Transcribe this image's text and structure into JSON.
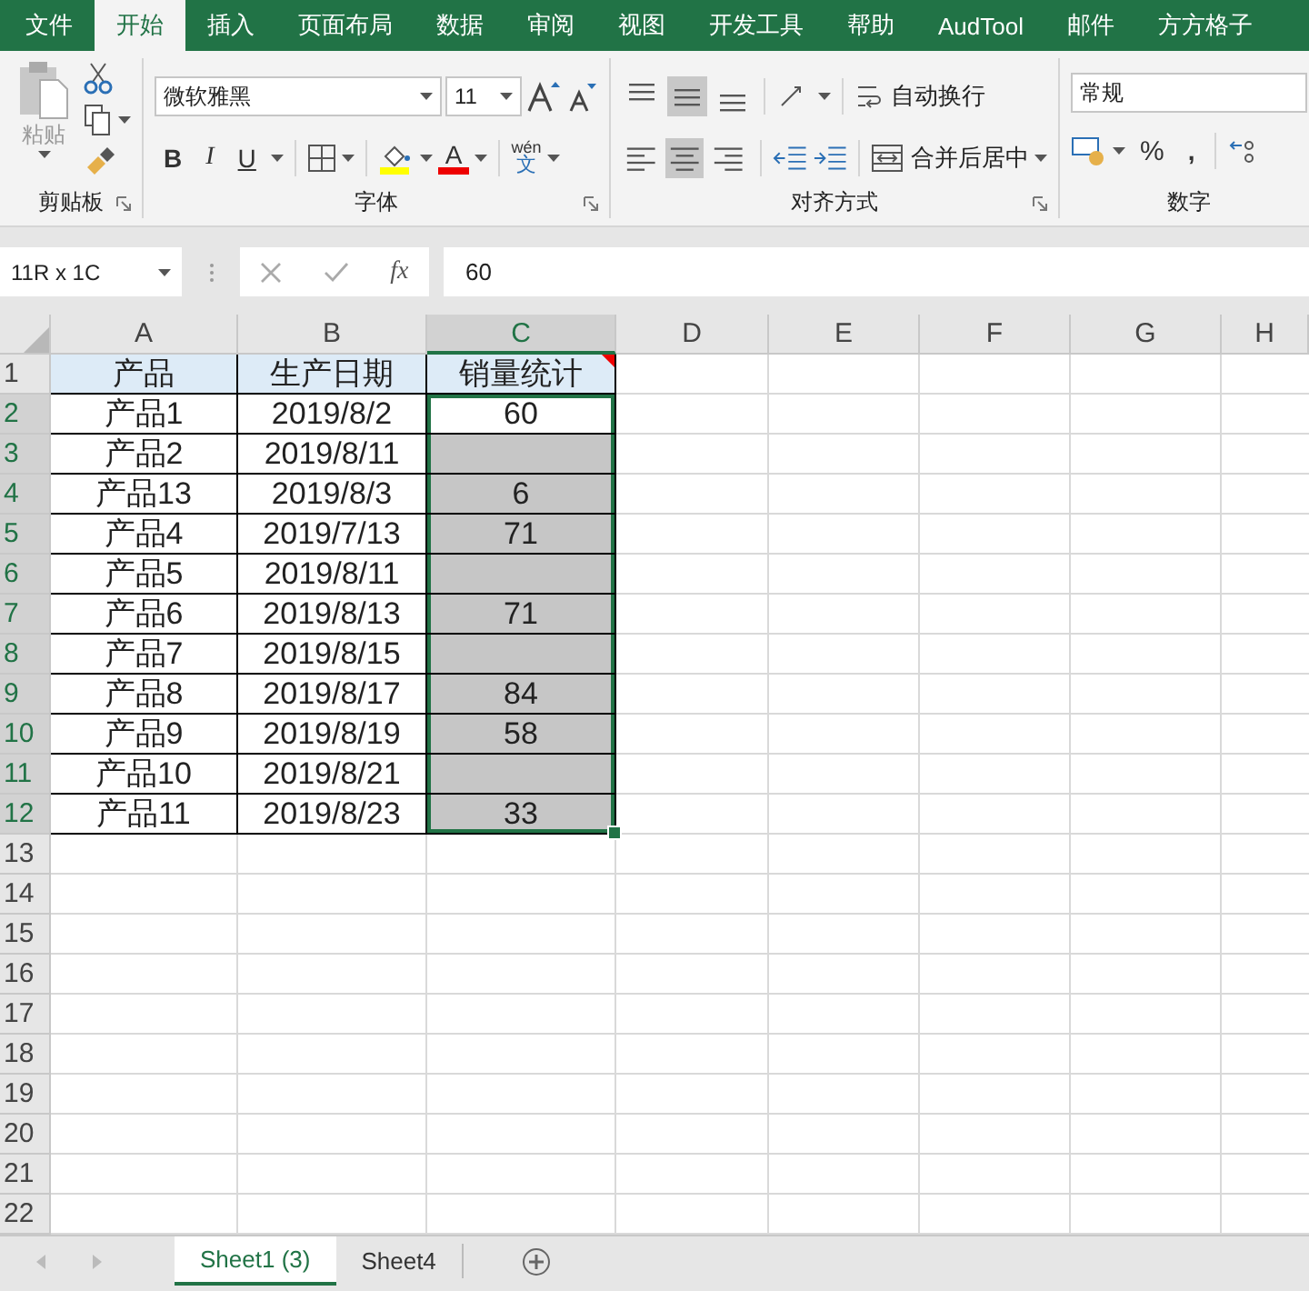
{
  "ribbon_tabs": [
    {
      "label": "文件",
      "selected": false
    },
    {
      "label": "开始",
      "selected": true
    },
    {
      "label": "插入",
      "selected": false
    },
    {
      "label": "页面布局",
      "selected": false
    },
    {
      "label": "数据",
      "selected": false
    },
    {
      "label": "审阅",
      "selected": false
    },
    {
      "label": "视图",
      "selected": false
    },
    {
      "label": "开发工具",
      "selected": false
    },
    {
      "label": "帮助",
      "selected": false
    },
    {
      "label": "AudTool",
      "selected": false
    },
    {
      "label": "邮件",
      "selected": false
    },
    {
      "label": "方方格子",
      "selected": false
    }
  ],
  "ribbon": {
    "clipboard": {
      "paste_label": "粘贴",
      "group_label": "剪贴板"
    },
    "font": {
      "font_name": "微软雅黑",
      "font_size": "11",
      "bold": "B",
      "italic": "I",
      "underline": "U",
      "font_color_letter": "A",
      "phonetic_top": "wén",
      "phonetic_bottom": "文",
      "group_label": "字体"
    },
    "alignment": {
      "vertical_align": [
        {
          "selected": false
        },
        {
          "selected": true
        },
        {
          "selected": false
        }
      ],
      "horizontal_align": [
        {
          "selected": false
        },
        {
          "selected": true
        },
        {
          "selected": false
        }
      ],
      "wrap_label": "自动换行",
      "merge_label": "合并后居中",
      "group_label": "对齐方式"
    },
    "number": {
      "format": "常规",
      "percent": "%",
      "comma": ",",
      "group_label": "数字"
    }
  },
  "formula_bar": {
    "name_box": "11R x 1C",
    "fx": "fx",
    "value": "60"
  },
  "sheet": {
    "columns": [
      {
        "label": "A",
        "selected": false
      },
      {
        "label": "B",
        "selected": false
      },
      {
        "label": "C",
        "selected": true
      },
      {
        "label": "D",
        "selected": false
      },
      {
        "label": "E",
        "selected": false
      },
      {
        "label": "F",
        "selected": false
      },
      {
        "label": "G",
        "selected": false
      },
      {
        "label": "H",
        "selected": false
      }
    ],
    "row_numbers": [
      {
        "label": "1",
        "selected": false
      },
      {
        "label": "2",
        "selected": true
      },
      {
        "label": "3",
        "selected": true
      },
      {
        "label": "4",
        "selected": true
      },
      {
        "label": "5",
        "selected": true
      },
      {
        "label": "6",
        "selected": true
      },
      {
        "label": "7",
        "selected": true
      },
      {
        "label": "8",
        "selected": true
      },
      {
        "label": "9",
        "selected": true
      },
      {
        "label": "10",
        "selected": true
      },
      {
        "label": "11",
        "selected": true
      },
      {
        "label": "12",
        "selected": true
      },
      {
        "label": "13",
        "selected": false
      },
      {
        "label": "14",
        "selected": false
      },
      {
        "label": "15",
        "selected": false
      },
      {
        "label": "16",
        "selected": false
      },
      {
        "label": "17",
        "selected": false
      },
      {
        "label": "18",
        "selected": false
      },
      {
        "label": "19",
        "selected": false
      },
      {
        "label": "20",
        "selected": false
      },
      {
        "label": "21",
        "selected": false
      },
      {
        "label": "22",
        "selected": false
      }
    ],
    "header_row": {
      "cells": [
        "产品",
        "生产日期",
        "销量统计"
      ],
      "comment_on_last": true
    },
    "data_rows": [
      {
        "a": "产品1",
        "b": "2019/8/2",
        "c": "60",
        "selected": true,
        "active": true
      },
      {
        "a": "产品2",
        "b": "2019/8/11",
        "selected": true,
        "active": false
      },
      {
        "a": "产品13",
        "b": "2019/8/3",
        "c": "6",
        "selected": true,
        "active": false
      },
      {
        "a": "产品4",
        "b": "2019/7/13",
        "c": "71",
        "selected": true,
        "active": false
      },
      {
        "a": "产品5",
        "b": "2019/8/11",
        "selected": true,
        "active": false
      },
      {
        "a": "产品6",
        "b": "2019/8/13",
        "c": "71",
        "selected": true,
        "active": false
      },
      {
        "a": "产品7",
        "b": "2019/8/15",
        "selected": true,
        "active": false
      },
      {
        "a": "产品8",
        "b": "2019/8/17",
        "c": "84",
        "selected": true,
        "active": false
      },
      {
        "a": "产品9",
        "b": "2019/8/19",
        "c": "58",
        "selected": true,
        "active": false
      },
      {
        "a": "产品10",
        "b": "2019/8/21",
        "selected": true,
        "active": false
      },
      {
        "a": "产品11",
        "b": "2019/8/23",
        "c": "33",
        "selected": true,
        "active": false
      }
    ]
  },
  "sheet_tabs": [
    {
      "label": "Sheet1 (3)",
      "selected": true
    },
    {
      "label": "Sheet4",
      "selected": false
    }
  ]
}
